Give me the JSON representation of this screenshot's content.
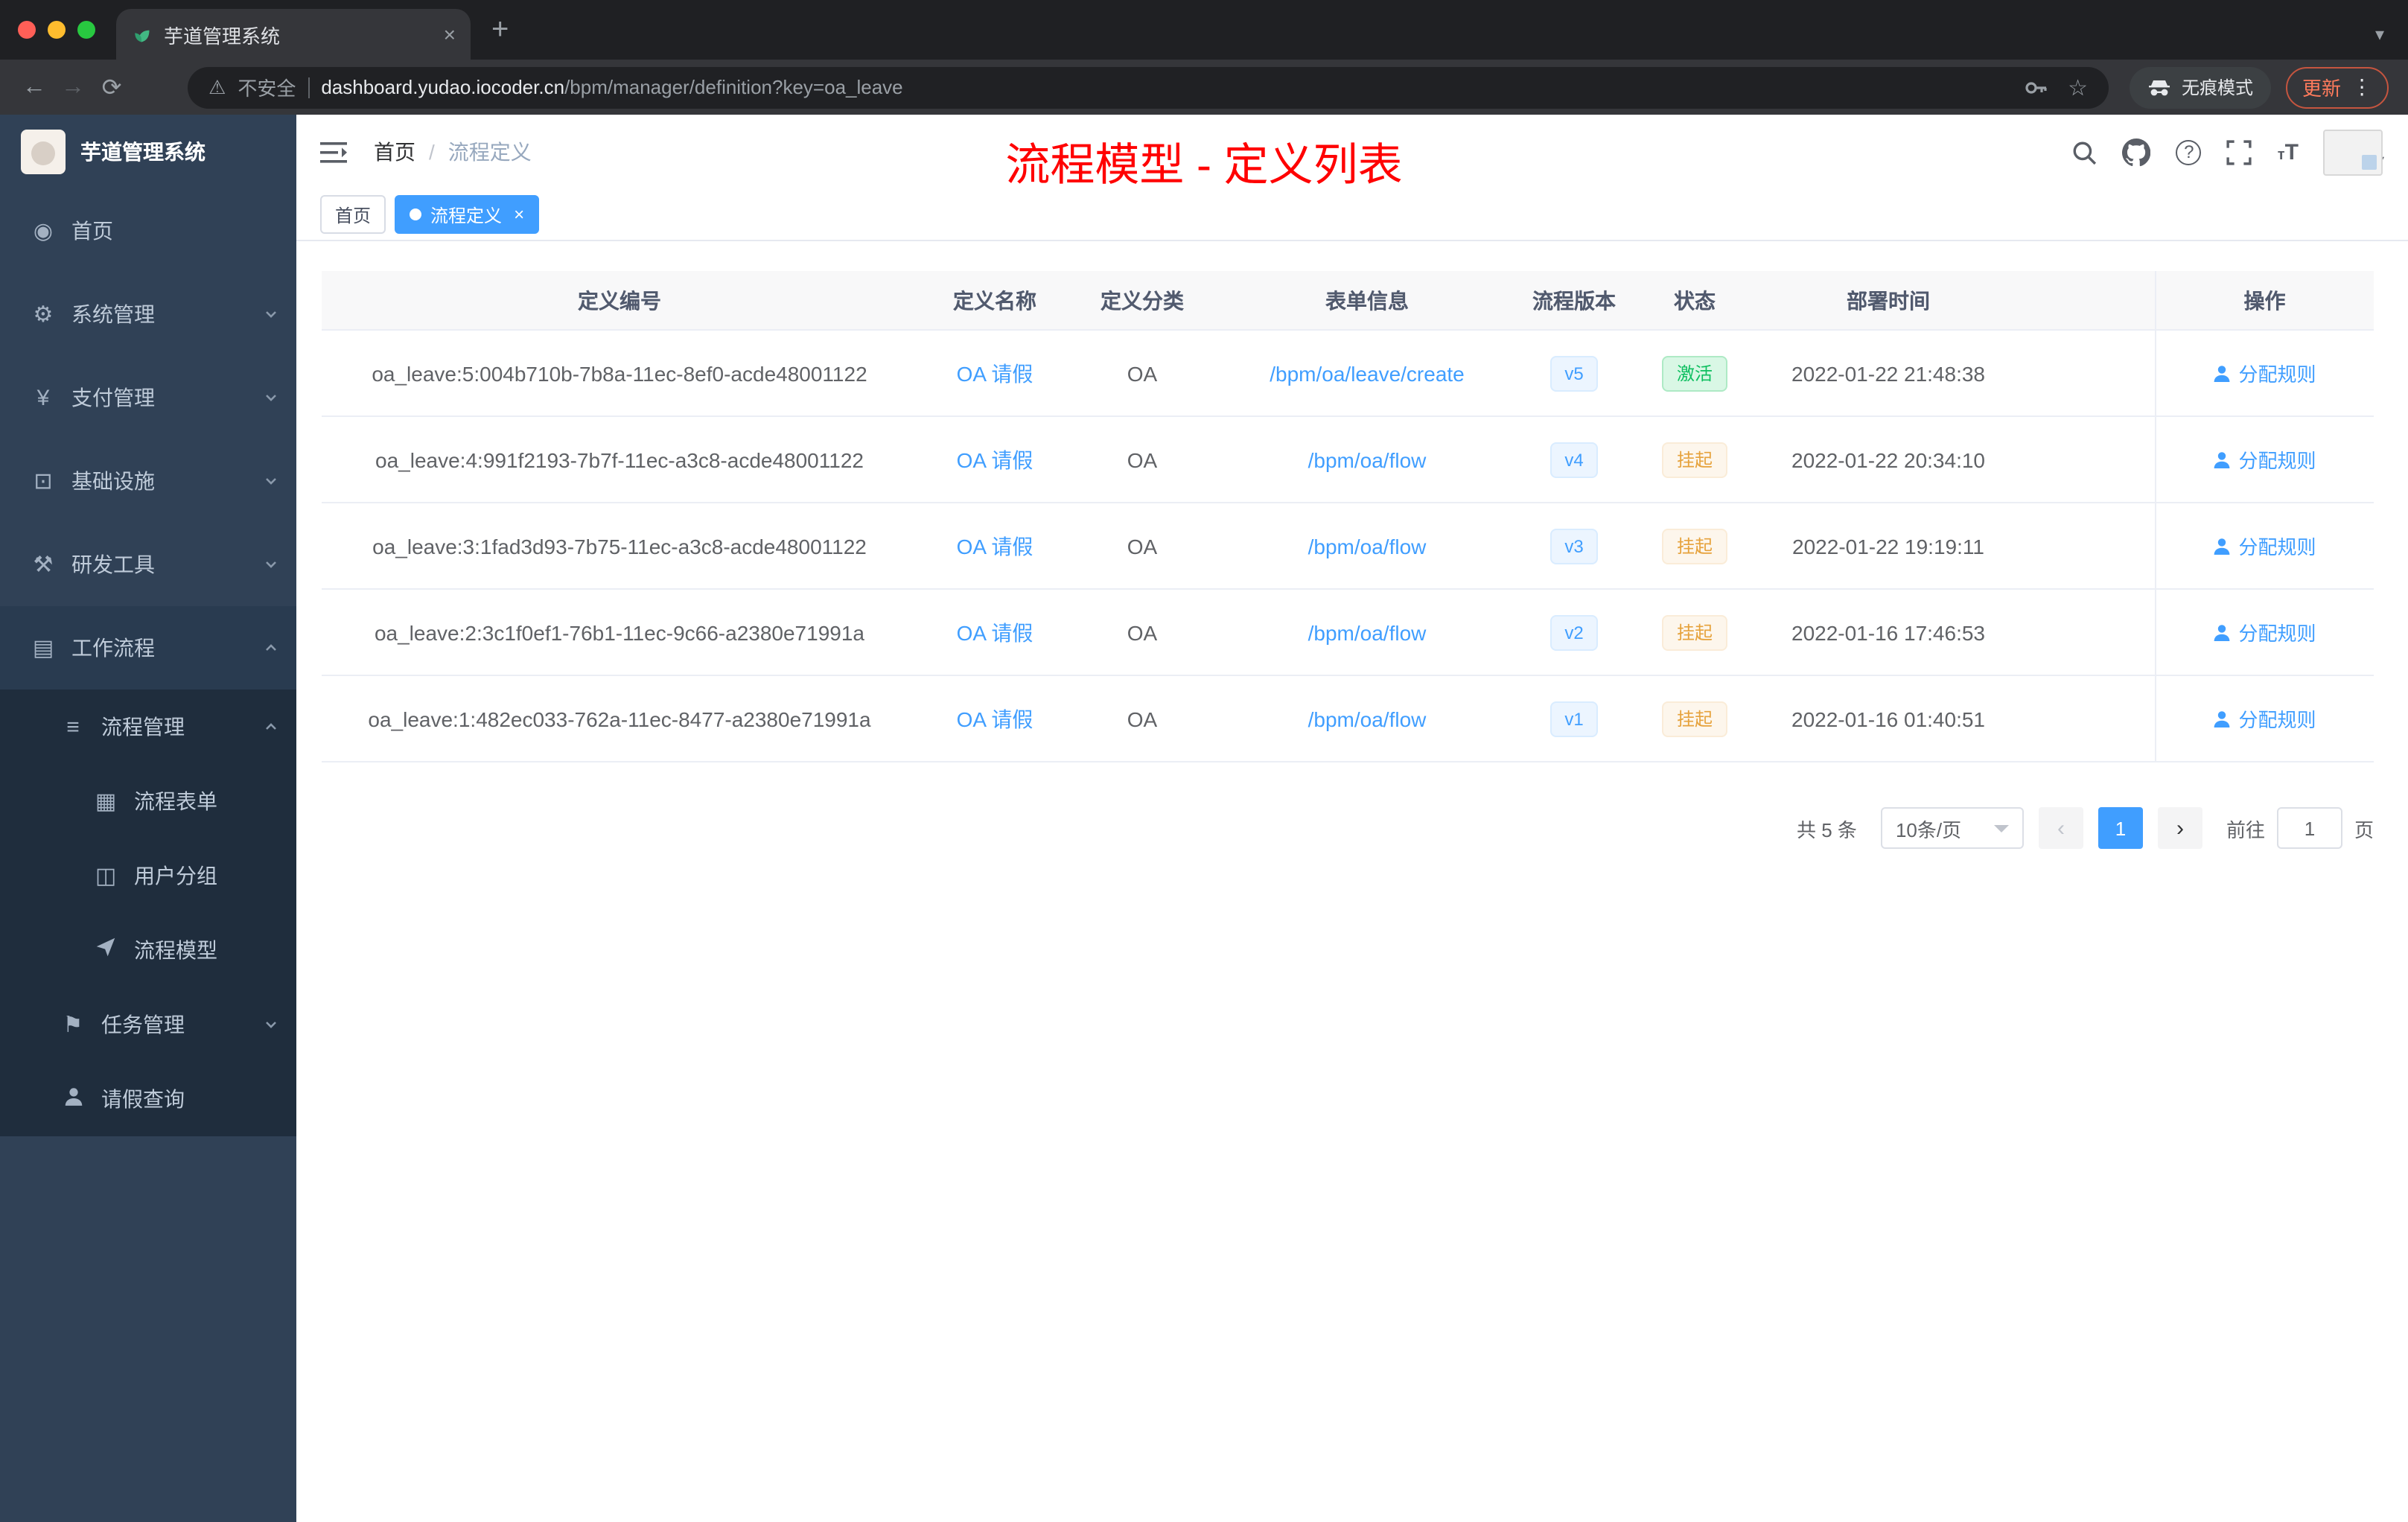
{
  "browser": {
    "tab_title": "芋道管理系统",
    "security_label": "不安全",
    "url_host": "dashboard.yudao.iocoder.cn",
    "url_path": "/bpm/manager/definition?key=oa_leave",
    "incognito_label": "无痕模式",
    "update_label": "更新"
  },
  "icons": {
    "dashboard": "◉",
    "gear": "⚙",
    "yen": "¥",
    "infra": "⊡",
    "tools": "⚒",
    "workflow": "▤",
    "list": "≡",
    "form": "▦",
    "users": "◫",
    "task": "⚑",
    "warning": "⚠",
    "star": "☆",
    "close": "×",
    "plus": "+",
    "back": "←",
    "forward": "→",
    "reload": "⟳",
    "dots": "⋮",
    "caret": "▾",
    "prev": "‹",
    "next": "›"
  },
  "colors": {
    "accent": "#409eff",
    "sidebar_bg": "#304156",
    "submenu_bg": "#1f2d3d",
    "annotation_red": "#ff0000",
    "success": "#0fbf60",
    "warning": "#e6a23c"
  },
  "sidebar": {
    "logo_title": "芋道管理系统",
    "items": [
      {
        "label": "首页"
      },
      {
        "label": "系统管理"
      },
      {
        "label": "支付管理"
      },
      {
        "label": "基础设施"
      },
      {
        "label": "研发工具"
      },
      {
        "label": "工作流程"
      },
      {
        "label": "流程管理"
      },
      {
        "label": "流程表单"
      },
      {
        "label": "用户分组"
      },
      {
        "label": "流程模型"
      },
      {
        "label": "任务管理"
      },
      {
        "label": "请假查询"
      }
    ]
  },
  "header": {
    "breadcrumb_home": "首页",
    "breadcrumb_sep": "/",
    "breadcrumb_current": "流程定义",
    "annotation": "流程模型 - 定义列表"
  },
  "tags": {
    "home": "首页",
    "current": "流程定义"
  },
  "table": {
    "columns": [
      "定义编号",
      "定义名称",
      "定义分类",
      "表单信息",
      "流程版本",
      "状态",
      "部署时间",
      "操作"
    ],
    "rows": [
      {
        "id": "oa_leave:5:004b710b-7b8a-11ec-8ef0-acde48001122",
        "name": "OA 请假",
        "category": "OA",
        "form": "/bpm/oa/leave/create",
        "version": "v5",
        "status": "激活",
        "deploy_time": "2022-01-22 21:48:38",
        "action": "分配规则"
      },
      {
        "id": "oa_leave:4:991f2193-7b7f-11ec-a3c8-acde48001122",
        "name": "OA 请假",
        "category": "OA",
        "form": "/bpm/oa/flow",
        "version": "v4",
        "status": "挂起",
        "deploy_time": "2022-01-22 20:34:10",
        "action": "分配规则"
      },
      {
        "id": "oa_leave:3:1fad3d93-7b75-11ec-a3c8-acde48001122",
        "name": "OA 请假",
        "category": "OA",
        "form": "/bpm/oa/flow",
        "version": "v3",
        "status": "挂起",
        "deploy_time": "2022-01-22 19:19:11",
        "action": "分配规则"
      },
      {
        "id": "oa_leave:2:3c1f0ef1-76b1-11ec-9c66-a2380e71991a",
        "name": "OA 请假",
        "category": "OA",
        "form": "/bpm/oa/flow",
        "version": "v2",
        "status": "挂起",
        "deploy_time": "2022-01-16 17:46:53",
        "action": "分配规则"
      },
      {
        "id": "oa_leave:1:482ec033-762a-11ec-8477-a2380e71991a",
        "name": "OA 请假",
        "category": "OA",
        "form": "/bpm/oa/flow",
        "version": "v1",
        "status": "挂起",
        "deploy_time": "2022-01-16 01:40:51",
        "action": "分配规则"
      }
    ]
  },
  "pagination": {
    "total": "共 5 条",
    "page_size": "10条/页",
    "page": "1",
    "goto": "前往",
    "goto_value": "1",
    "unit": "页"
  }
}
